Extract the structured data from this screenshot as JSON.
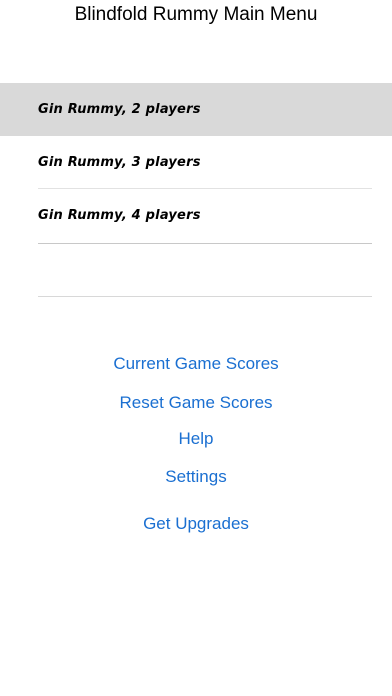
{
  "header": {
    "title": "Blindfold Rummy Main Menu"
  },
  "games": [
    {
      "label": "Gin Rummy, 2 players",
      "selected": true
    },
    {
      "label": "Gin Rummy, 3 players",
      "selected": false
    },
    {
      "label": "Gin Rummy, 4 players",
      "selected": false
    }
  ],
  "links": {
    "current_scores": "Current Game Scores",
    "reset_scores": "Reset Game Scores",
    "help": "Help",
    "settings": "Settings",
    "upgrades": "Get Upgrades"
  },
  "colors": {
    "link": "#1a6fd1",
    "selected_row": "#d9d9d9"
  }
}
